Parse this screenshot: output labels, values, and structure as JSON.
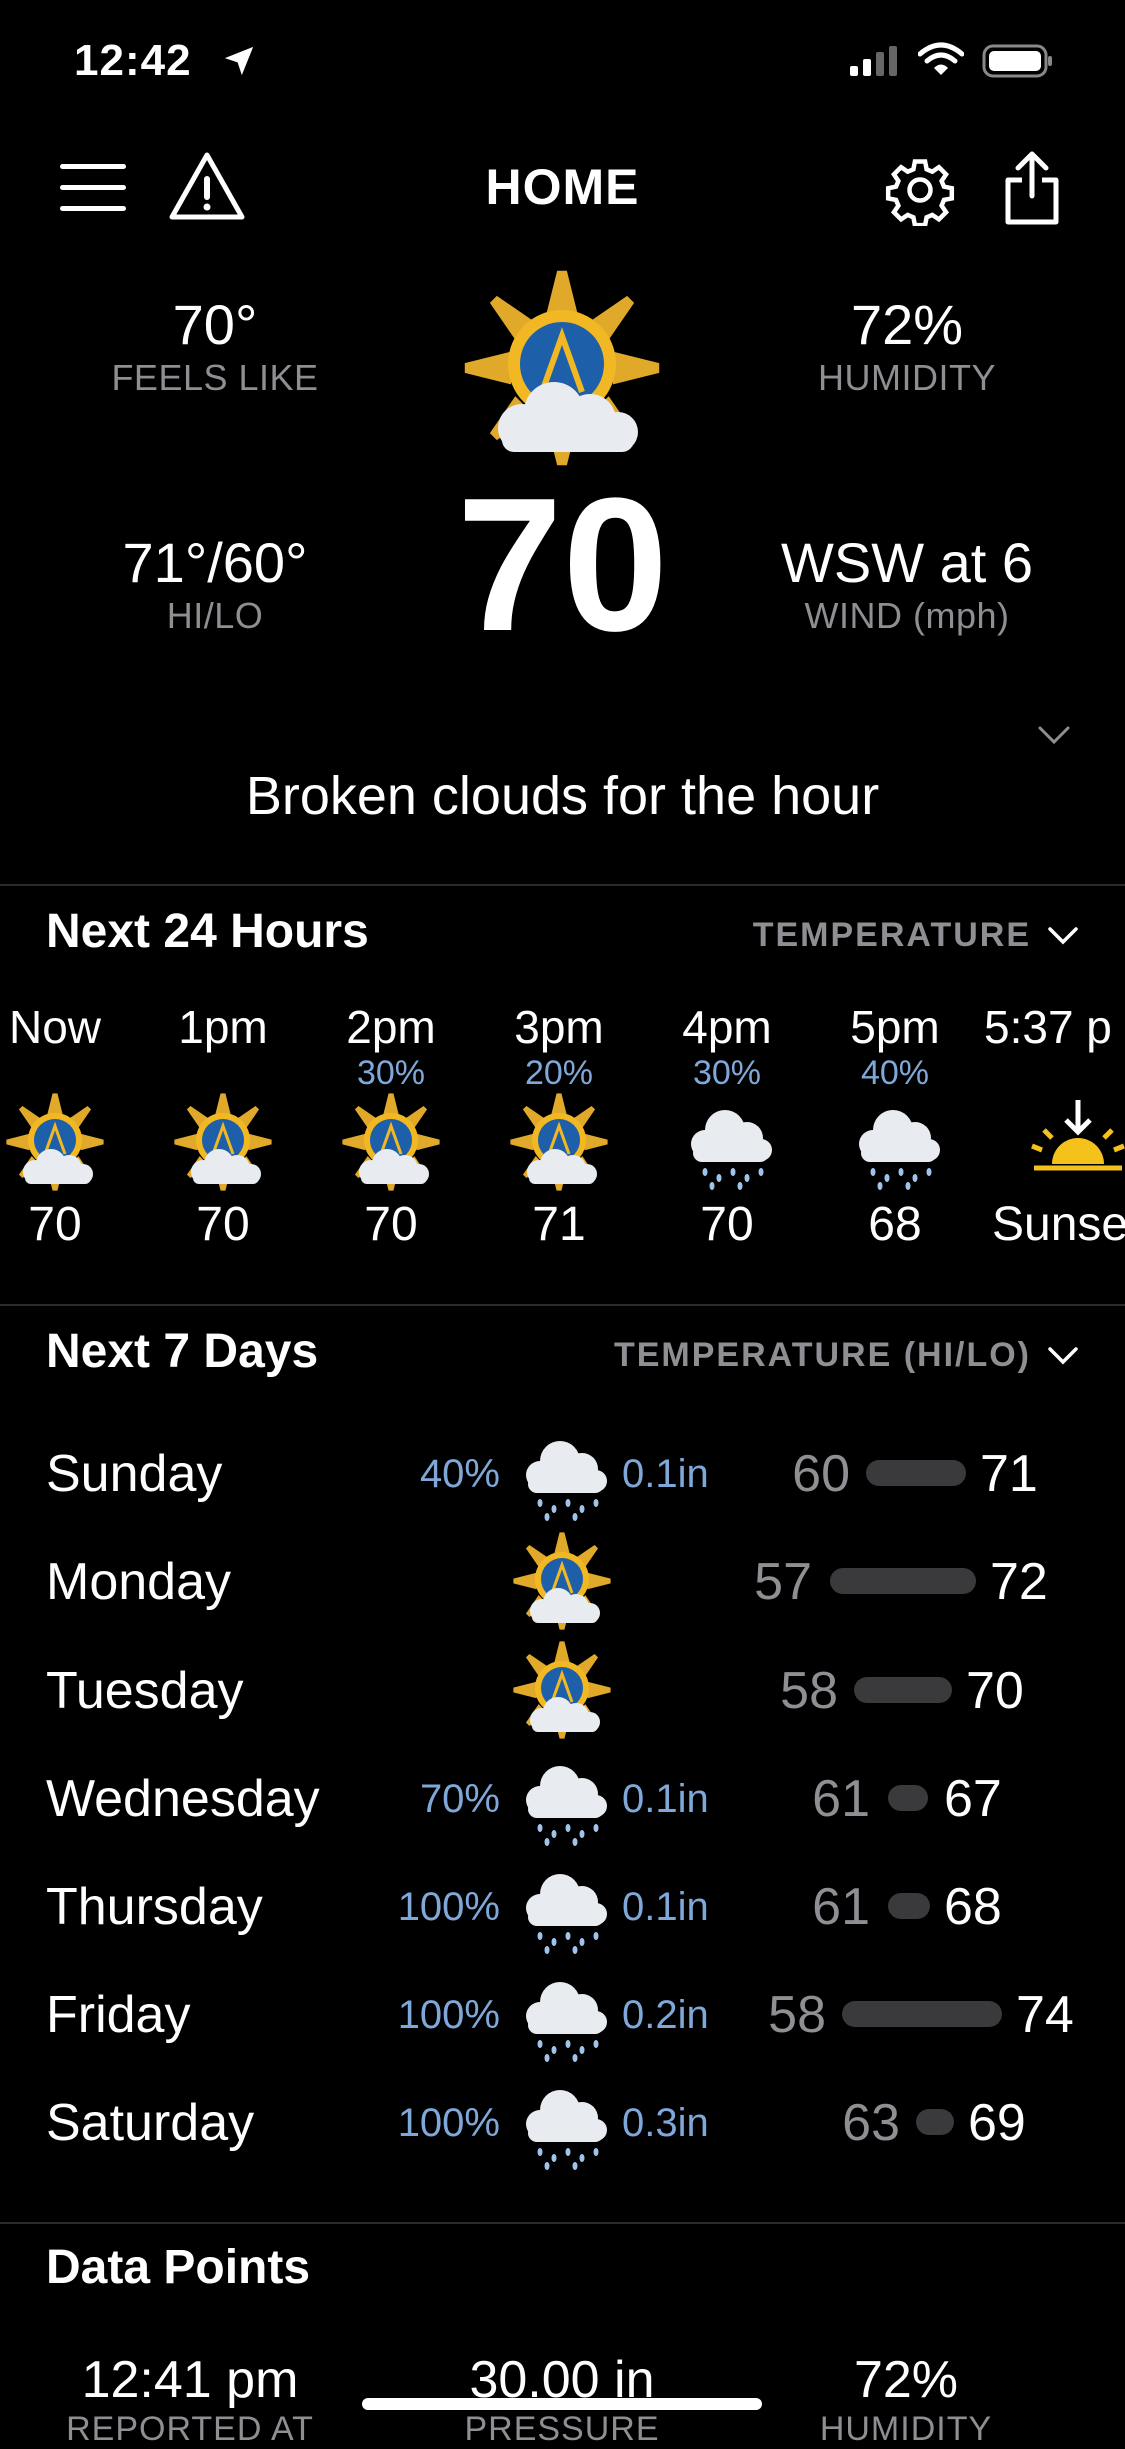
{
  "status_bar": {
    "time": "12:42"
  },
  "header": {
    "title": "HOME"
  },
  "current": {
    "feels_like": {
      "value": "70°",
      "label": "FEELS LIKE"
    },
    "humidity": {
      "value": "72%",
      "label": "HUMIDITY"
    },
    "hilo": {
      "value": "71°/60°",
      "label": "HI/LO"
    },
    "wind": {
      "value": "WSW at 6",
      "label": "WIND (mph)"
    },
    "temp": "70",
    "summary": "Broken clouds for the hour"
  },
  "hourly": {
    "title": "Next 24 Hours",
    "selector": "TEMPERATURE",
    "items": [
      {
        "time": "Now",
        "precip": "",
        "temp": "70",
        "icon": "partly-cloudy-icon"
      },
      {
        "time": "1pm",
        "precip": "",
        "temp": "70",
        "icon": "partly-cloudy-icon"
      },
      {
        "time": "2pm",
        "precip": "30%",
        "temp": "70",
        "icon": "partly-cloudy-icon"
      },
      {
        "time": "3pm",
        "precip": "20%",
        "temp": "71",
        "icon": "partly-cloudy-icon"
      },
      {
        "time": "4pm",
        "precip": "30%",
        "temp": "70",
        "icon": "rain-cloud-icon"
      },
      {
        "time": "5pm",
        "precip": "40%",
        "temp": "68",
        "icon": "rain-cloud-icon"
      },
      {
        "time": "5:37 p",
        "precip": "",
        "temp": "Sunse",
        "icon": "sunset-icon"
      }
    ]
  },
  "daily": {
    "title": "Next 7 Days",
    "selector": "TEMPERATURE (HI/LO)",
    "items": [
      {
        "day": "Sunday",
        "precip": "40%",
        "amount": "0.1in",
        "lo": "60",
        "hi": "71",
        "icon": "rain-cloud-icon"
      },
      {
        "day": "Monday",
        "precip": "",
        "amount": "",
        "lo": "57",
        "hi": "72",
        "icon": "partly-cloudy-icon"
      },
      {
        "day": "Tuesday",
        "precip": "",
        "amount": "",
        "lo": "58",
        "hi": "70",
        "icon": "partly-cloudy-icon"
      },
      {
        "day": "Wednesday",
        "precip": "70%",
        "amount": "0.1in",
        "lo": "61",
        "hi": "67",
        "icon": "rain-cloud-icon"
      },
      {
        "day": "Thursday",
        "precip": "100%",
        "amount": "0.1in",
        "lo": "61",
        "hi": "68",
        "icon": "rain-cloud-icon"
      },
      {
        "day": "Friday",
        "precip": "100%",
        "amount": "0.2in",
        "lo": "58",
        "hi": "74",
        "icon": "rain-cloud-icon"
      },
      {
        "day": "Saturday",
        "precip": "100%",
        "amount": "0.3in",
        "lo": "63",
        "hi": "69",
        "icon": "rain-cloud-icon"
      }
    ]
  },
  "data_points": {
    "title": "Data Points",
    "items": [
      {
        "value": "12:41 pm",
        "label": "REPORTED AT"
      },
      {
        "value": "30.00 in",
        "label": "PRESSURE"
      },
      {
        "value": "72%",
        "label": "HUMIDITY"
      }
    ]
  },
  "colors": {
    "accent": "#7fa8d9",
    "muted": "#8e8e93",
    "background": "#000000"
  }
}
